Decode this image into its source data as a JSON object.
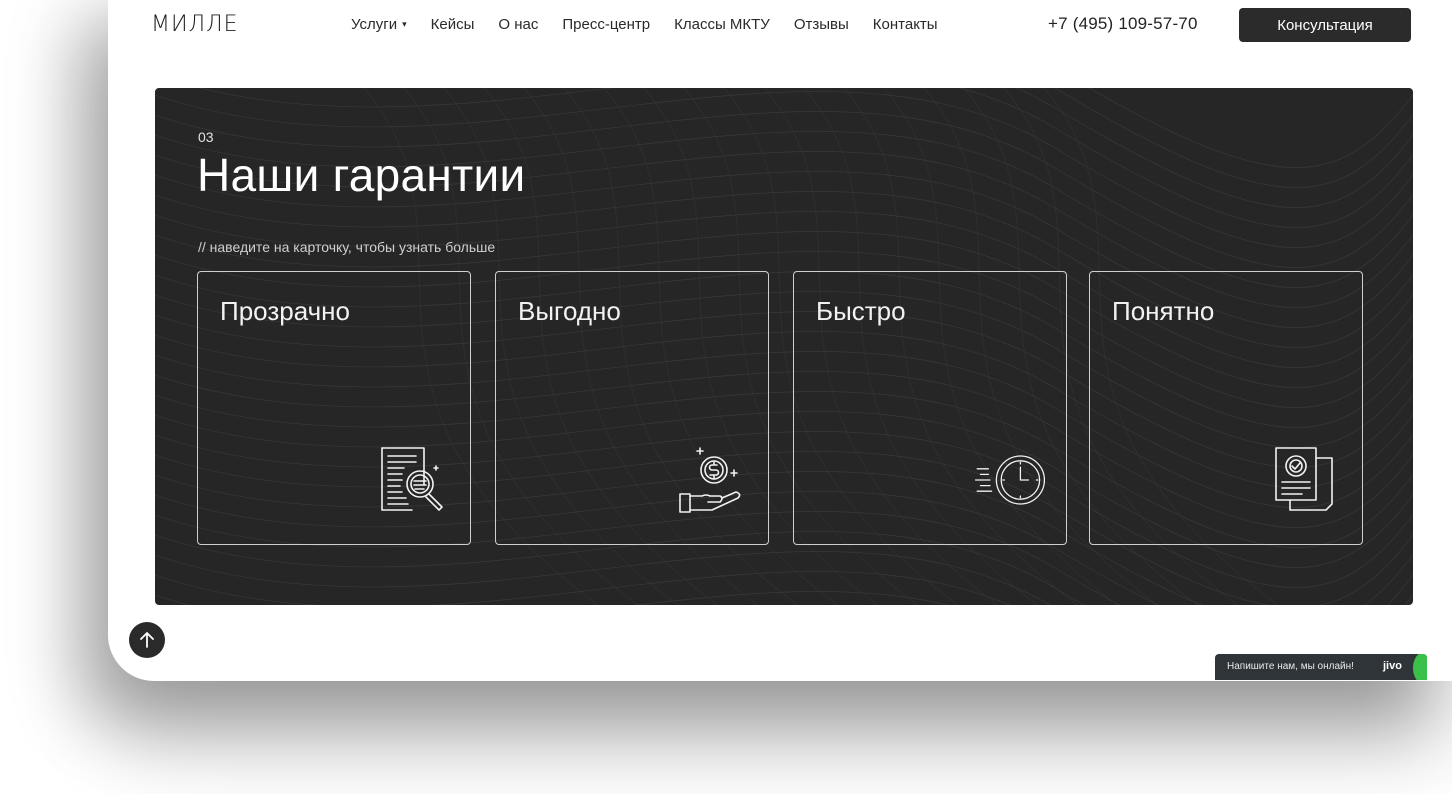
{
  "nav": {
    "logo": "МИЛЛЕ",
    "items": [
      {
        "label": "Услуги",
        "has_caret": true
      },
      {
        "label": "Кейсы"
      },
      {
        "label": "О нас"
      },
      {
        "label": "Пресс-центр"
      },
      {
        "label": "Классы МКТУ"
      },
      {
        "label": "Отзывы"
      },
      {
        "label": "Контакты"
      }
    ],
    "caret": "▾",
    "phone": "+7 (495) 109-57-70",
    "cta_label": "Консультация"
  },
  "section": {
    "number": "03",
    "title": "Наши гарантии",
    "hint": "// наведите на карточку, чтобы узнать больше",
    "cards": [
      {
        "title": "Прозрачно",
        "icon": "document-magnifier-icon"
      },
      {
        "title": "Выгодно",
        "icon": "coin-hand-icon"
      },
      {
        "title": "Быстро",
        "icon": "fast-clock-icon"
      },
      {
        "title": "Понятно",
        "icon": "checked-documents-icon"
      }
    ]
  },
  "chat_widget": {
    "text": "Напишите нам, мы онлайн!",
    "brand": "jivo"
  },
  "colors": {
    "panel_bg": "#262626",
    "cta_bg": "#2b2b2b",
    "chat_bg": "#2f3439",
    "chat_accent": "#3cc04c"
  }
}
